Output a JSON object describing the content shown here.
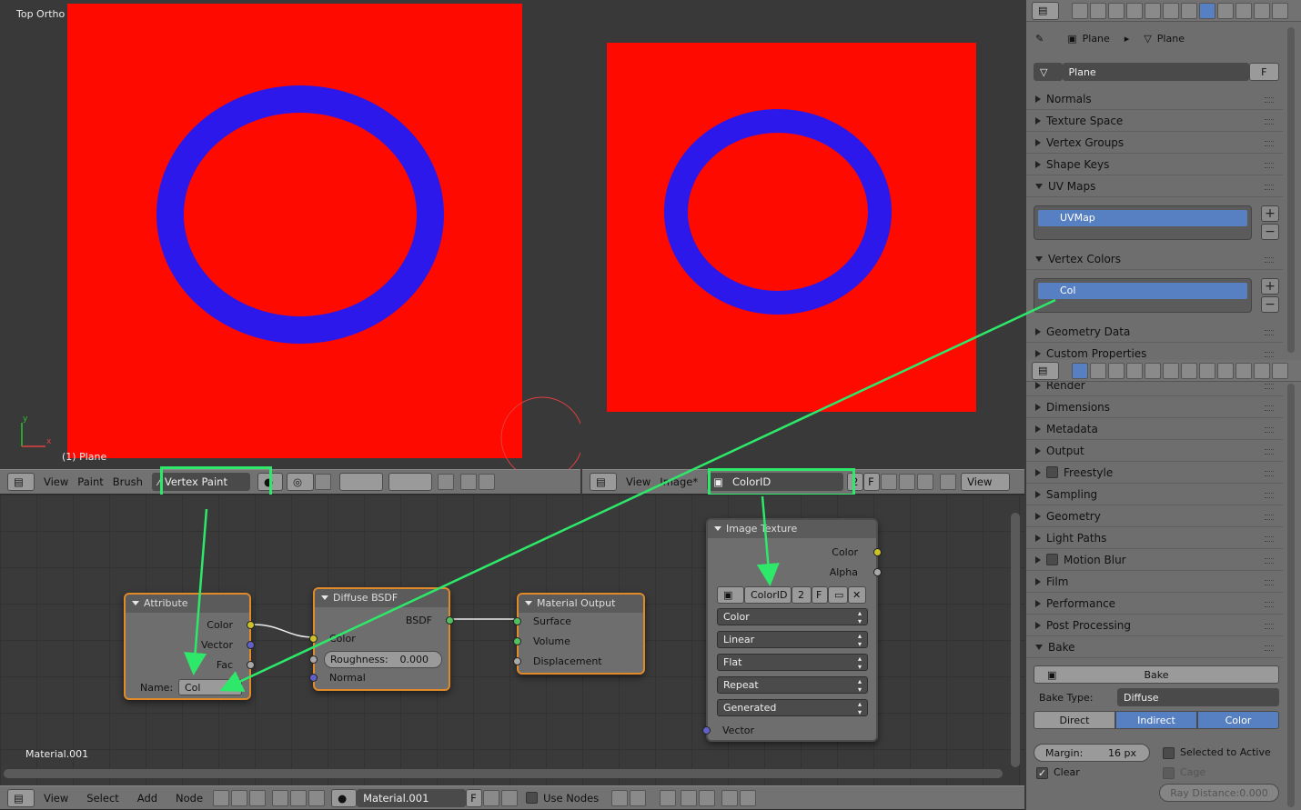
{
  "viewport": {
    "title": "Top Ortho",
    "object_label": "(1) Plane",
    "axis_y": "y",
    "axis_x": "x"
  },
  "viewport_header": {
    "menus": [
      "View",
      "Paint",
      "Brush"
    ],
    "mode": "Vertex Paint"
  },
  "image_header": {
    "menus": [
      "View",
      "Image*"
    ],
    "image_name": "ColorID",
    "users": "2",
    "fake": "F",
    "view_label": "View"
  },
  "nodes": {
    "attribute": {
      "title": "Attribute",
      "outputs": [
        "Color",
        "Vector",
        "Fac"
      ],
      "name_label": "Name:",
      "name_value": "Col"
    },
    "diffuse": {
      "title": "Diffuse BSDF",
      "output": "BSDF",
      "inputs": [
        "Color",
        "Normal"
      ],
      "roughness_label": "Roughness:",
      "roughness_value": "0.000"
    },
    "output": {
      "title": "Material Output",
      "inputs": [
        "Surface",
        "Volume",
        "Displacement"
      ]
    },
    "image_texture": {
      "title": "Image Texture",
      "outputs": [
        "Color",
        "Alpha"
      ],
      "image_name": "ColorID",
      "users": "2",
      "fake": "F",
      "color_space": "Color",
      "interpolation": "Linear",
      "projection": "Flat",
      "extension": "Repeat",
      "source": "Generated",
      "input": "Vector"
    }
  },
  "node_editor": {
    "material_label": "Material.001"
  },
  "node_header": {
    "menus": [
      "View",
      "Select",
      "Add",
      "Node"
    ],
    "material": "Material.001",
    "fake": "F",
    "use_nodes": "Use Nodes"
  },
  "data_props": {
    "breadcrumb": [
      "Plane",
      "Plane"
    ],
    "mesh_name": "Plane",
    "mesh_fake": "F",
    "panels_top": [
      "Normals",
      "Texture Space",
      "Vertex Groups",
      "Shape Keys"
    ],
    "uv_maps": {
      "title": "UV Maps",
      "item": "UVMap"
    },
    "vertex_colors": {
      "title": "Vertex Colors",
      "item": "Col"
    },
    "panels_bottom": [
      "Geometry Data",
      "Custom Properties"
    ]
  },
  "render_props": {
    "panels": [
      "Render",
      "Dimensions",
      "Metadata",
      "Output",
      "Freestyle",
      "Sampling",
      "Geometry",
      "Light Paths",
      "Motion Blur",
      "Film",
      "Performance",
      "Post Processing"
    ],
    "bake": {
      "title": "Bake",
      "button": "Bake",
      "type_label": "Bake Type:",
      "type_value": "Diffuse",
      "tabs": [
        "Direct",
        "Indirect",
        "Color"
      ],
      "margin_label": "Margin:",
      "margin_value": "16 px",
      "selected_to_active": "Selected to Active",
      "clear": "Clear",
      "cage": "Cage",
      "ray_distance": "Ray Distance:0.000"
    }
  },
  "colors": {
    "highlight": "#2ee86a",
    "red": "#ff0a00",
    "blue": "#1a1aff",
    "selection": "#5680c2"
  }
}
